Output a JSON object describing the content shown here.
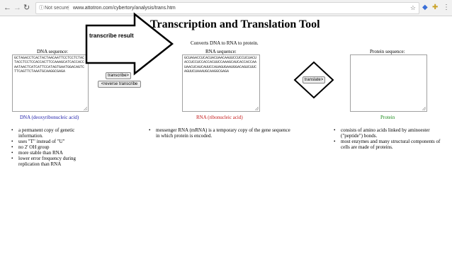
{
  "browser": {
    "back_icon": "back-arrow-icon",
    "forward_icon": "forward-arrow-icon",
    "reload_icon": "reload-icon",
    "not_secure_label": "Not secure",
    "url": "www.attotron.com/cybertory/analysis/trans.htm"
  },
  "page": {
    "title": "Transcription and Translation Tool",
    "converts_note": "Converts DNA to RNA to protein."
  },
  "dna": {
    "label": "DNA sequence:",
    "sequence": "GCTAGACCTCACTACTAACAATTCCTCCTCTACTACCTCCTCCACCACTTCCAAAGCATCACCACCAATAACTCATCATTCCATAGTGAATGGACAGTCTTCAGTTCTAAATGCAAGGCGAGA",
    "molecule_name": "DNA (deoxyribonucleic acid)",
    "facts": [
      "a permanent copy of genetic information.",
      "uses \"T\" instead of \"U\"",
      "no 2' OH group",
      "more stable than RNA",
      "lower error frequency during replication than RNA"
    ]
  },
  "buttons": {
    "transcribe": "transcribe>",
    "reverse_transcribe": "<reverse transcribe",
    "translate": "translate>"
  },
  "rna": {
    "label": "RNA sequence:",
    "sequence": "GCUAGACCUCACUACUAACAAUUCCUCCUCUACUACCUCCUCCACCACUUCCAAAGCAUCACCACCAAUAACUCAUCAUUCCAUAGUGAAUGGACAGUCUUCAGUUCUAAAUGCAAGGCGAGA",
    "molecule_name": "RNA (ribonucleic acid)",
    "facts": [
      "messenger RNA (mRNA) is a temporary copy of the gene sequence in which protein is encoded."
    ]
  },
  "protein": {
    "label": "Protein sequence:",
    "sequence": "",
    "molecule_name": "Protein",
    "facts": [
      "consists of amino acids linked by aminoester (\"peptide\") bonds.",
      "most enzymes and many structural components of cells are made of proteins."
    ]
  },
  "annotation": {
    "text": "transcribe result"
  },
  "colors": {
    "dna_name": "#1a1aa8",
    "rna_name": "#c41818",
    "protein_name": "#1a8a1a"
  }
}
